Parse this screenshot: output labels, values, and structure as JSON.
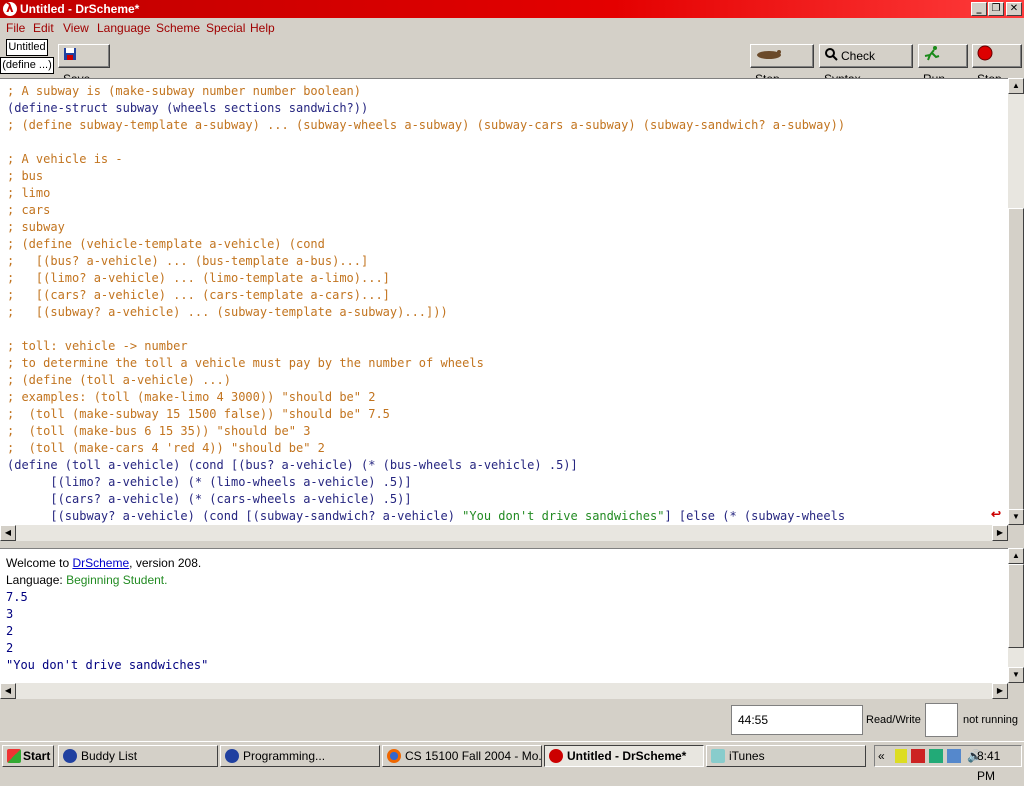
{
  "window": {
    "title": "Untitled - DrScheme*"
  },
  "menu": [
    "File",
    "Edit",
    "View",
    "Language",
    "Scheme",
    "Special",
    "Help"
  ],
  "toolbar": {
    "tab_label": "Untitled",
    "define_label": "(define ...)",
    "save": "Save",
    "step": "Step",
    "check_syntax": "Check Syntax",
    "run": "Run",
    "stop": "Stop"
  },
  "editor": {
    "lines": [
      {
        "c": "comment",
        "t": "; A subway is (make-subway number number boolean)"
      },
      {
        "c": "plain",
        "t": "(define-struct subway (wheels sections sandwich?))"
      },
      {
        "c": "comment",
        "t": "; (define subway-template a-subway) ... (subway-wheels a-subway) (subway-cars a-subway) (subway-sandwich? a-subway))"
      },
      {
        "c": "plain",
        "t": ""
      },
      {
        "c": "comment",
        "t": "; A vehicle is -"
      },
      {
        "c": "comment",
        "t": "; bus"
      },
      {
        "c": "comment",
        "t": "; limo"
      },
      {
        "c": "comment",
        "t": "; cars"
      },
      {
        "c": "comment",
        "t": "; subway"
      },
      {
        "c": "comment",
        "t": "; (define (vehicle-template a-vehicle) (cond"
      },
      {
        "c": "comment",
        "t": ";   [(bus? a-vehicle) ... (bus-template a-bus)...]"
      },
      {
        "c": "comment",
        "t": ";   [(limo? a-vehicle) ... (limo-template a-limo)...]"
      },
      {
        "c": "comment",
        "t": ";   [(cars? a-vehicle) ... (cars-template a-cars)...]"
      },
      {
        "c": "comment",
        "t": ";   [(subway? a-vehicle) ... (subway-template a-subway)...]))"
      },
      {
        "c": "plain",
        "t": ""
      },
      {
        "c": "comment",
        "t": "; toll: vehicle -> number"
      },
      {
        "c": "comment",
        "t": "; to determine the toll a vehicle must pay by the number of wheels"
      },
      {
        "c": "comment",
        "t": "; (define (toll a-vehicle) ...)"
      },
      {
        "c": "comment",
        "t": "; examples: (toll (make-limo 4 3000)) \"should be\" 2"
      },
      {
        "c": "comment",
        "t": ";  (toll (make-subway 15 1500 false)) \"should be\" 7.5"
      },
      {
        "c": "comment",
        "t": ";  (toll (make-bus 6 15 35)) \"should be\" 3"
      },
      {
        "c": "comment",
        "t": ";  (toll (make-cars 4 'red 4)) \"should be\" 2"
      },
      {
        "c": "plain",
        "t": "(define (toll a-vehicle) (cond [(bus? a-vehicle) (* (bus-wheels a-vehicle) .5)]"
      },
      {
        "c": "plain",
        "t": "      [(limo? a-vehicle) (* (limo-wheels a-vehicle) .5)]"
      },
      {
        "c": "plain",
        "t": "      [(cars? a-vehicle) (* (cars-wheels a-vehicle) .5)]"
      },
      {
        "c": "mixed",
        "t": "      [(subway? a-vehicle) (cond [(subway-sandwich? a-vehicle) ",
        "s": "\"You don't drive sandwiches\"",
        "r": "] [else (* (subway-wheels"
      }
    ]
  },
  "repl": {
    "welcome_prefix": "Welcome to ",
    "welcome_link": "DrScheme",
    "welcome_suffix": ", version 208.",
    "language_prefix": "Language: ",
    "language_value": "Beginning Student.",
    "outputs": [
      "7.5",
      "3",
      "2",
      "2",
      "\"You don't drive sandwiches\""
    ]
  },
  "status": {
    "position": "44:55",
    "mode": "Read/Write",
    "state": "not running"
  },
  "taskbar": {
    "start": "Start",
    "tasks": [
      "Buddy List",
      "Programming...",
      "CS 15100 Fall 2004 - Mo...",
      "Untitled - DrScheme*",
      "iTunes"
    ],
    "clock": "8:41 PM"
  },
  "colors": {
    "title": "#c00000",
    "comment": "#c2741f",
    "code": "#262680",
    "string": "#228b22",
    "menu": "#a00000"
  }
}
